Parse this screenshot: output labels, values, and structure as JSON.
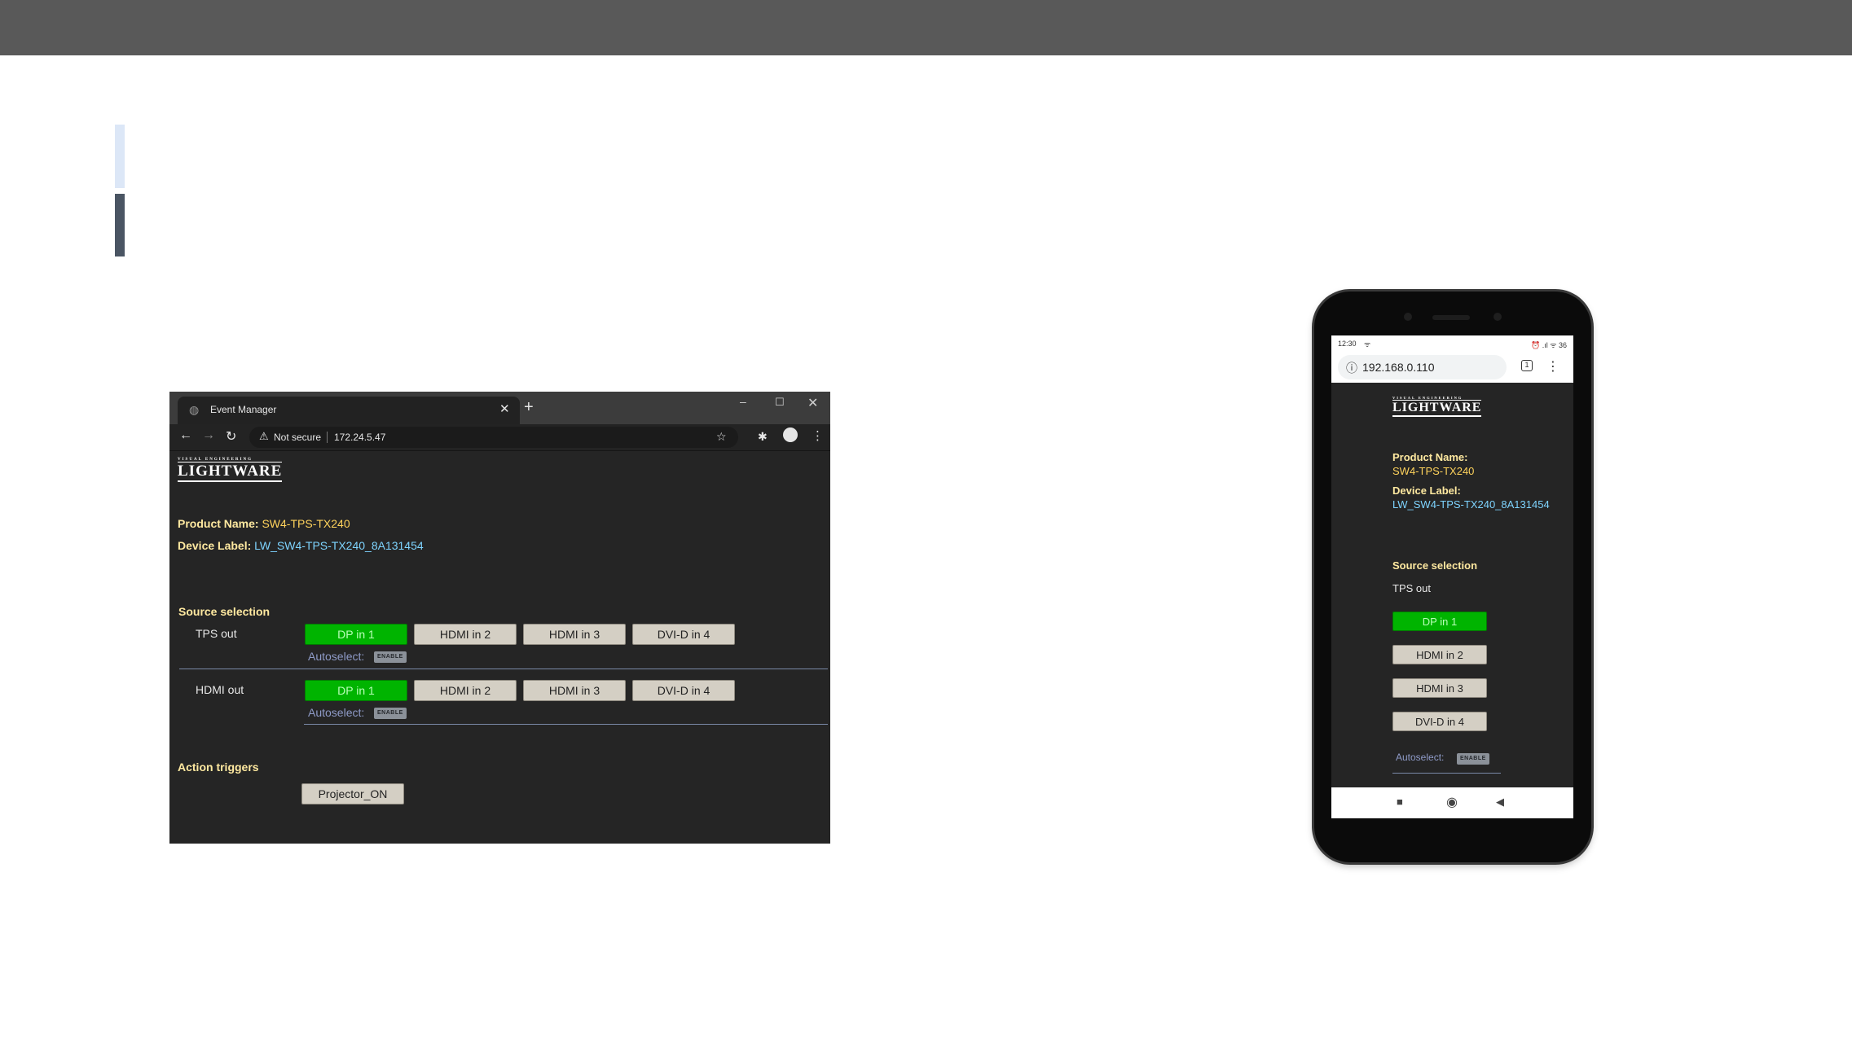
{
  "browser": {
    "tab_title": "Event Manager",
    "tab_close": "✕",
    "new_tab": "+",
    "win_min": "–",
    "win_max": "☐",
    "win_close": "✕",
    "back": "←",
    "forward": "→",
    "reload": "↻",
    "warning_glyph": "⚠",
    "not_secure": "Not secure",
    "url": "172.24.5.47",
    "star": "☆",
    "kebab": "⋮"
  },
  "device": {
    "logo_tag": "VISUAL ENGINEERING",
    "logo_word": "LIGHTWARE",
    "product_name_label": "Product Name:",
    "product_name": "SW4-TPS-TX240",
    "device_label_label": "Device Label:",
    "device_label": "LW_SW4-TPS-TX240_8A131454",
    "source_selection_title": "Source selection",
    "tps_out_label": "TPS out",
    "hdmi_out_label": "HDMI out",
    "sources": [
      "DP in 1",
      "HDMI in 2",
      "HDMI in 3",
      "DVI-D in 4"
    ],
    "autoselect_label": "Autoselect:",
    "enable_badge": "ENABLE",
    "action_triggers_title": "Action triggers",
    "action_button": "Projector_ON"
  },
  "phone": {
    "time": "12:30",
    "status_icons": "⏰ .ıl ᯤ 36",
    "url": "192.168.0.110",
    "info_glyph": "ⓘ",
    "tab_count": "1",
    "kebab": "⋮",
    "nav_square": "■",
    "nav_home": "◉",
    "nav_back": "◀"
  },
  "colors": {
    "topbar": "#595959",
    "active_source": "#00b400",
    "idle_source": "#d4cfc4",
    "label_yellow": "#ffe9a0",
    "product_yellow": "#ffd35c",
    "device_cyan": "#7ed4ff"
  }
}
